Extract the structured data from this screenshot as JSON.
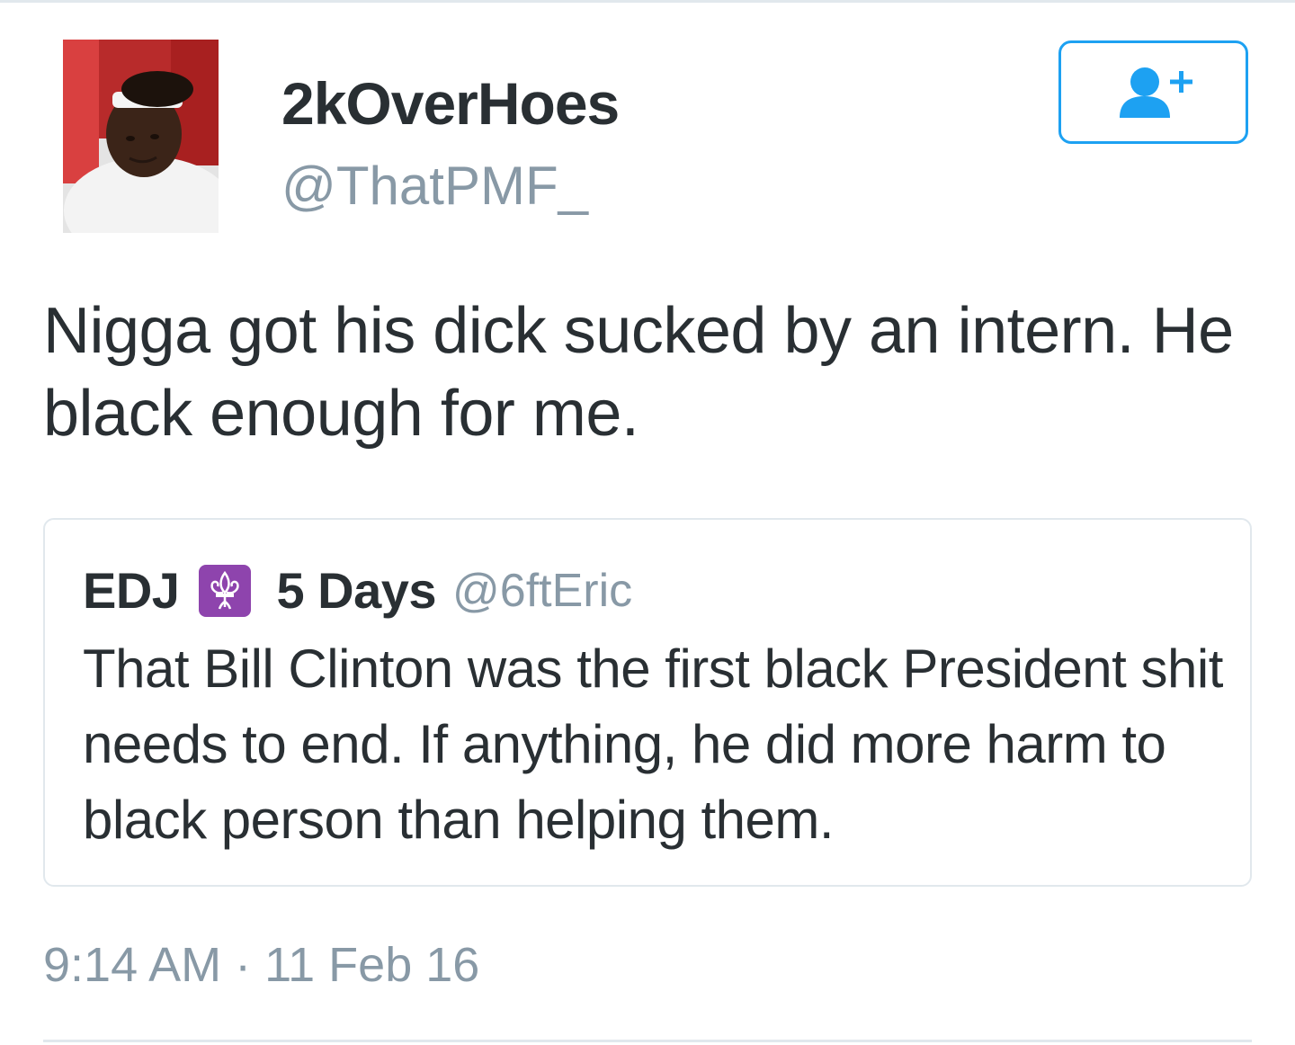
{
  "author": {
    "display_name": "2kOverHoes",
    "handle": "@ThatPMF_",
    "avatar_icon": "profile-photo"
  },
  "follow_button": {
    "icon": "add-user-icon",
    "accent_color": "#1da1f2"
  },
  "tweet": {
    "text": "Nigga got his dick sucked by an intern. He black enough for me.",
    "timestamp": "9:14 AM · 11 Feb 16"
  },
  "quoted_tweet": {
    "name": "EDJ",
    "badge_icon": "fleur-de-lis-icon",
    "badge_color": "#8e44ad",
    "name_suffix": "5 Days",
    "handle": "@6ftEric",
    "text": "That Bill Clinton was the first black President shit needs to end. If anything, he did more harm to black person than helping them."
  },
  "colors": {
    "primary_text": "#292f33",
    "secondary_text": "#8899a6",
    "border": "#e1e8ed"
  }
}
